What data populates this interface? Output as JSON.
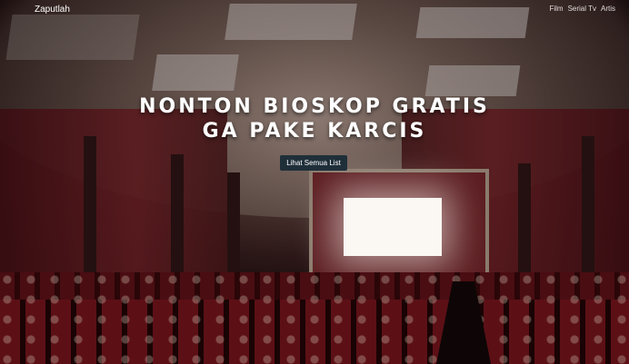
{
  "navbar": {
    "brand": "Zaputlah",
    "links": [
      "Film",
      "Serial Tv",
      "Artis"
    ]
  },
  "hero": {
    "headline_line1": "NONTON BIOSKOP GRATIS",
    "headline_line2": "GA PAKE KARCIS",
    "cta_label": "Lihat Semua List"
  },
  "colors": {
    "cta_background": "#1f2f3a",
    "text": "#ffffff"
  }
}
